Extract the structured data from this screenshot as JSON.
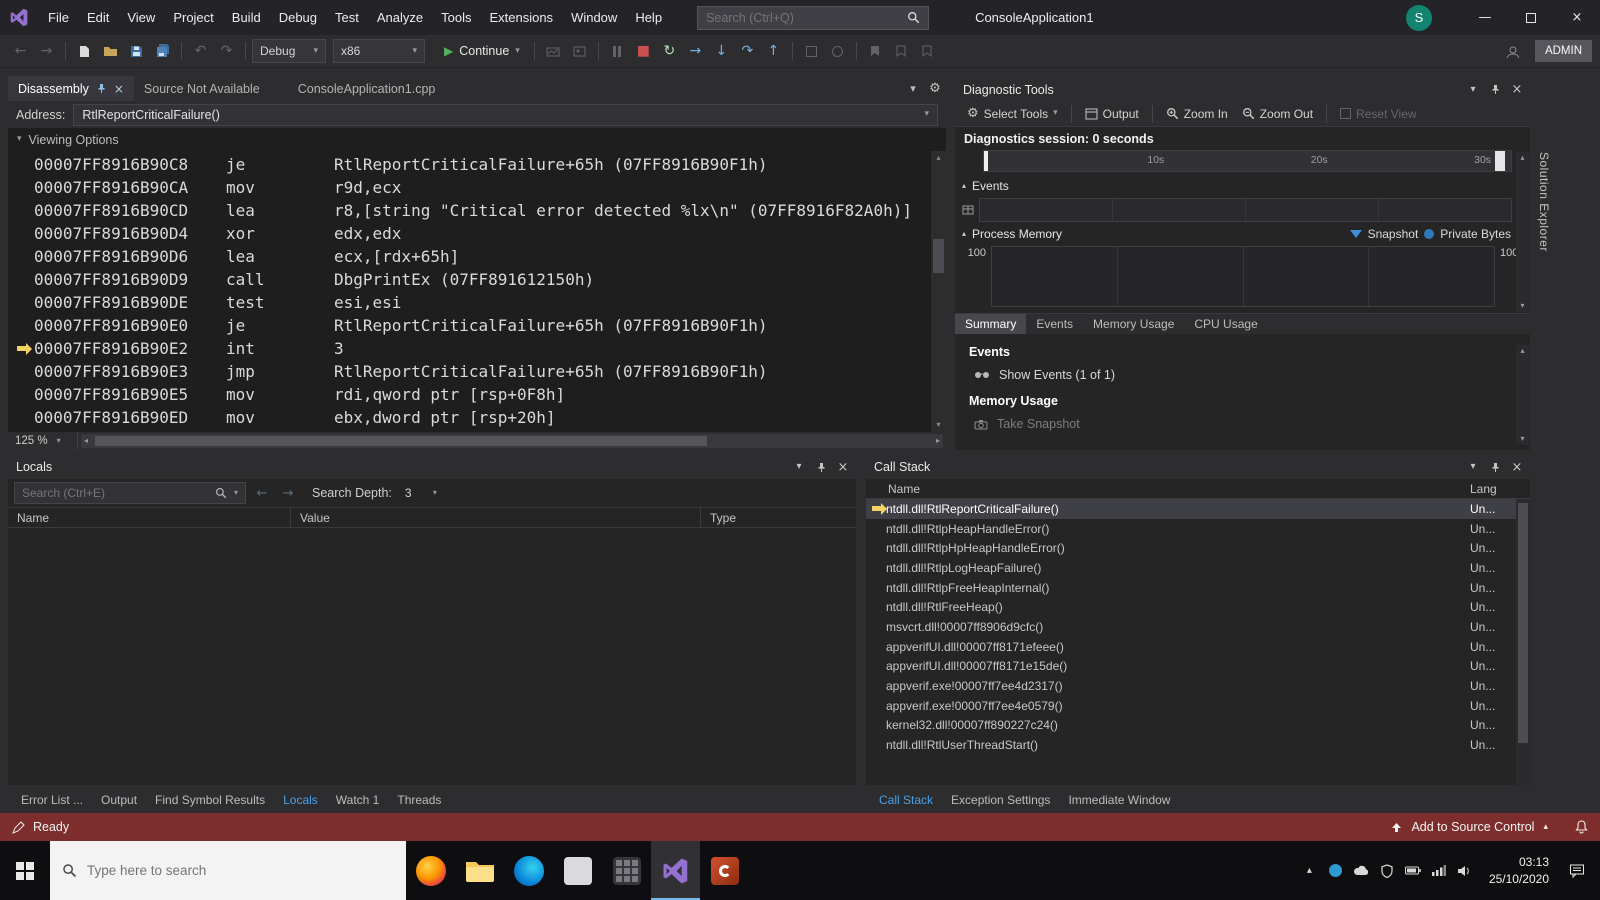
{
  "icons": {
    "chevron_down": "▾",
    "chevron_up": "▴",
    "chevron_left": "◂",
    "chevron_right": "▸",
    "close": "×",
    "back_arrow": "←",
    "forward_arrow": "→",
    "undo": "↶",
    "redo": "↷",
    "restart": "↻",
    "play": "▶",
    "stop": "■",
    "show_next": "→",
    "step_into": "↓",
    "step_over": "↷",
    "step_out": "↑",
    "gear": "⚙",
    "minimize": "—"
  },
  "title_bar": {
    "menus": [
      "File",
      "Edit",
      "View",
      "Project",
      "Build",
      "Debug",
      "Test",
      "Analyze",
      "Tools",
      "Extensions",
      "Window",
      "Help"
    ],
    "search_placeholder": "Search (Ctrl+Q)",
    "window_title": "ConsoleApplication1",
    "avatar_letter": "S"
  },
  "toolbar": {
    "config_value": "Debug",
    "platform_value": "x86",
    "continue_label": "Continue",
    "admin_label": "ADMIN"
  },
  "editor": {
    "tabs": [
      {
        "label": "Disassembly"
      },
      {
        "label": "Source Not Available"
      },
      {
        "label": "ConsoleApplication1.cpp"
      }
    ],
    "address_label": "Address:",
    "address_value": "RtlReportCriticalFailure()",
    "viewing_options_label": "Viewing Options",
    "zoom_value": "125 %",
    "current_index": 8,
    "lines": [
      {
        "address": "00007FF8916B90C8",
        "mnemonic": "je",
        "operands": "RtlReportCriticalFailure+65h (07FF8916B90F1h)"
      },
      {
        "address": "00007FF8916B90CA",
        "mnemonic": "mov",
        "operands": "r9d,ecx"
      },
      {
        "address": "00007FF8916B90CD",
        "mnemonic": "lea",
        "operands": "r8,[string \"Critical error detected %lx\\n\" (07FF8916F82A0h)]"
      },
      {
        "address": "00007FF8916B90D4",
        "mnemonic": "xor",
        "operands": "edx,edx"
      },
      {
        "address": "00007FF8916B90D6",
        "mnemonic": "lea",
        "operands": "ecx,[rdx+65h]"
      },
      {
        "address": "00007FF8916B90D9",
        "mnemonic": "call",
        "operands": "DbgPrintEx (07FF891612150h)"
      },
      {
        "address": "00007FF8916B90DE",
        "mnemonic": "test",
        "operands": "esi,esi"
      },
      {
        "address": "00007FF8916B90E0",
        "mnemonic": "je",
        "operands": "RtlReportCriticalFailure+65h (07FF8916B90F1h)"
      },
      {
        "address": "00007FF8916B90E2",
        "mnemonic": "int",
        "operands": "3"
      },
      {
        "address": "00007FF8916B90E3",
        "mnemonic": "jmp",
        "operands": "RtlReportCriticalFailure+65h (07FF8916B90F1h)"
      },
      {
        "address": "00007FF8916B90E5",
        "mnemonic": "mov",
        "operands": "rdi,qword ptr [rsp+0F8h]"
      },
      {
        "address": "00007FF8916B90ED",
        "mnemonic": "mov",
        "operands": "ebx,dword ptr [rsp+20h]"
      }
    ]
  },
  "diagnostics": {
    "title": "Diagnostic Tools",
    "select_tools_label": "Select Tools",
    "output_label": "Output",
    "zoom_in_label": "Zoom In",
    "zoom_out_label": "Zoom Out",
    "reset_view_label": "Reset View",
    "session_label": "Diagnostics session: 0 seconds",
    "timeline_ticks": [
      "10s",
      "20s",
      "30s"
    ],
    "events_section_label": "Events",
    "process_memory_label": "Process Memory",
    "snapshot_legend": "Snapshot",
    "private_bytes_legend": "Private Bytes",
    "memory_max_left": "100",
    "memory_max_right": "100",
    "tabs": [
      "Summary",
      "Events",
      "Memory Usage",
      "CPU Usage"
    ],
    "summary": {
      "events_heading": "Events",
      "show_events_label": "Show Events (1 of 1)",
      "memory_heading": "Memory Usage",
      "take_snapshot_label": "Take Snapshot"
    }
  },
  "locals": {
    "title": "Locals",
    "search_placeholder": "Search (Ctrl+E)",
    "search_depth_label": "Search Depth:",
    "search_depth_value": "3",
    "columns": [
      "Name",
      "Value",
      "Type"
    ],
    "bottom_tabs": [
      "Error List ...",
      "Output",
      "Find Symbol Results",
      "Locals",
      "Watch 1",
      "Threads"
    ]
  },
  "call_stack": {
    "title": "Call Stack",
    "name_column": "Name",
    "lang_column": "Lang",
    "lang_value": "Un...",
    "selected_index": 0,
    "frames": [
      "ntdll.dll!RtlReportCriticalFailure()",
      "ntdll.dll!RtlpHeapHandleError()",
      "ntdll.dll!RtlpHpHeapHandleError()",
      "ntdll.dll!RtlpLogHeapFailure()",
      "ntdll.dll!RtlpFreeHeapInternal()",
      "ntdll.dll!RtlFreeHeap()",
      "msvcrt.dll!00007ff8906d9cfc()",
      "appverifUI.dll!00007ff8171efeee()",
      "appverifUI.dll!00007ff8171e15de()",
      "appverif.exe!00007ff7ee4d2317()",
      "appverif.exe!00007ff7ee4e0579()",
      "kernel32.dll!00007ff890227c24()",
      "ntdll.dll!RtlUserThreadStart()"
    ],
    "bottom_tabs": [
      "Call Stack",
      "Exception Settings",
      "Immediate Window"
    ]
  },
  "status_bar": {
    "ready_label": "Ready",
    "source_control_label": "Add to Source Control"
  },
  "solution_explorer_label": "Solution Explorer",
  "taskbar": {
    "search_placeholder": "Type here to search",
    "time": "03:13",
    "date": "25/10/2020"
  }
}
